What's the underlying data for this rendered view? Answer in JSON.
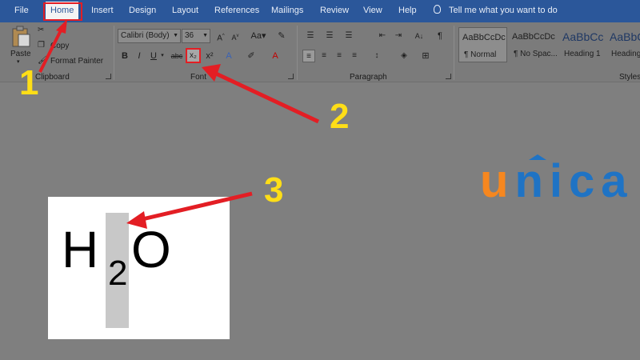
{
  "tabs": [
    "File",
    "Home",
    "Insert",
    "Design",
    "Layout",
    "References",
    "Mailings",
    "Review",
    "View",
    "Help"
  ],
  "tell_me": "Tell me what you want to do",
  "clipboard": {
    "paste_label": "Paste",
    "copy_label": "Copy",
    "format_painter_label": "Format Painter",
    "group_label": "Clipboard"
  },
  "font": {
    "font_name": "Calibri (Body)",
    "font_size": "36",
    "group_label": "Font",
    "bold": "B",
    "italic": "I",
    "underline": "U",
    "strikethrough": "abc",
    "subscript": "x₂",
    "superscript": "x²"
  },
  "paragraph": {
    "group_label": "Paragraph"
  },
  "styles": {
    "group_label": "Styles",
    "items": [
      {
        "preview": "AaBbCcDc",
        "name": "¶ Normal"
      },
      {
        "preview": "AaBbCcDc",
        "name": "¶ No Spac..."
      },
      {
        "preview": "AaBbCc",
        "name": "Heading 1"
      },
      {
        "preview": "AaBbCc",
        "name": "Heading"
      }
    ]
  },
  "example": {
    "h": "H",
    "sub": "2",
    "o": "O"
  },
  "steps": [
    "1",
    "2",
    "3"
  ],
  "logo": {
    "u": "u",
    "rest": "nica"
  },
  "colors": {
    "accent": "#2b579a",
    "highlight_red": "#e31e24",
    "step_yellow": "#ffde17",
    "logo_orange": "#f6871f",
    "logo_blue": "#1f73c4"
  }
}
